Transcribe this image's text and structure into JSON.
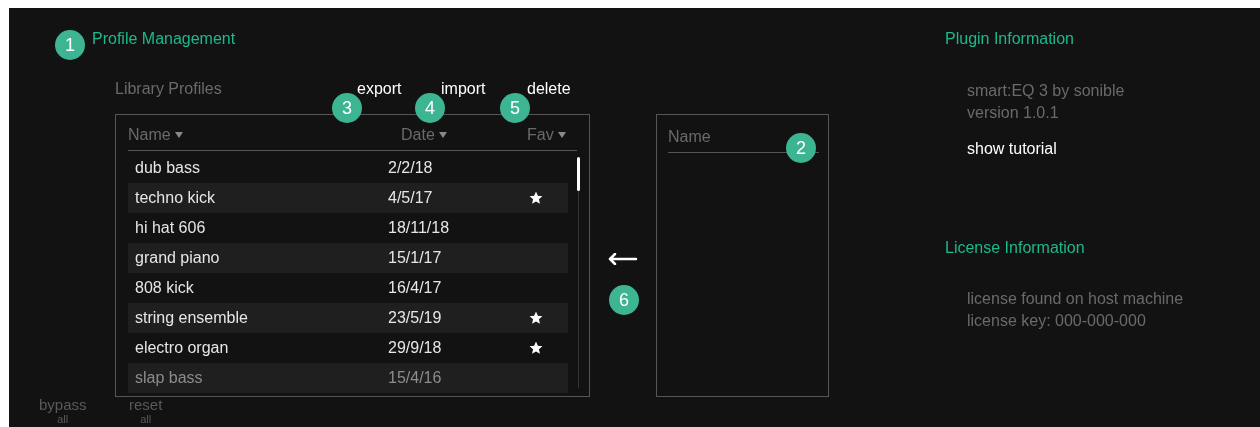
{
  "profile_management": {
    "title": "Profile Management",
    "library_label": "Library Profiles",
    "actions": [
      "export",
      "import",
      "delete"
    ],
    "columns": [
      {
        "label": "Name"
      },
      {
        "label": "Date"
      },
      {
        "label": "Fav"
      }
    ],
    "rows": [
      {
        "name": "dub bass",
        "date": "2/2/18",
        "favorite": false
      },
      {
        "name": "techno kick",
        "date": "4/5/17",
        "favorite": true
      },
      {
        "name": "hi hat 606",
        "date": "18/11/18",
        "favorite": false
      },
      {
        "name": "grand piano",
        "date": "15/1/17",
        "favorite": false
      },
      {
        "name": "808 kick",
        "date": "16/4/17",
        "favorite": false
      },
      {
        "name": "string ensemble",
        "date": "23/5/19",
        "favorite": true
      },
      {
        "name": "electro organ",
        "date": "29/9/18",
        "favorite": true
      },
      {
        "name": "slap bass",
        "date": "15/4/16",
        "favorite": false
      }
    ],
    "new_profile": {
      "placeholder": "Name"
    }
  },
  "plugin_information": {
    "title": "Plugin Information",
    "lines": [
      "smart:EQ 3 by sonible",
      "version 1.0.1"
    ],
    "tutorial_link": "show tutorial"
  },
  "license_information": {
    "title": "License Information",
    "lines": [
      "license found on host machine",
      "license key: 000-000-000"
    ]
  },
  "bottom_controls": [
    {
      "label": "bypass",
      "sublabel": "all"
    },
    {
      "label": "reset",
      "sublabel": "all"
    }
  ],
  "annotation_badges": [
    "1",
    "3",
    "4",
    "5",
    "2",
    "6"
  ]
}
